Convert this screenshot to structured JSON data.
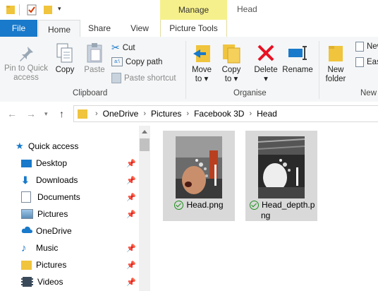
{
  "window": {
    "title": "Head",
    "contextual_tab": "Manage"
  },
  "tabs": [
    "File",
    "Home",
    "Share",
    "View",
    "Picture Tools"
  ],
  "ribbon": {
    "clipboard": {
      "pin_label": "Pin to Quick\naccess",
      "copy_label": "Copy",
      "paste_label": "Paste",
      "cut_label": "Cut",
      "copy_path_label": "Copy path",
      "paste_shortcut_label": "Paste shortcut",
      "group_label": "Clipboard"
    },
    "organise": {
      "move_to_label": "Move\nto ▾",
      "copy_to_label": "Copy\nto ▾",
      "delete_label": "Delete\n▾",
      "rename_label": "Rename",
      "group_label": "Organise"
    },
    "new": {
      "new_folder_label": "New\nfolder",
      "new_item_label": "New",
      "easy_access_label": "Eas",
      "group_label": "New"
    }
  },
  "breadcrumb": [
    "OneDrive",
    "Pictures",
    "Facebook 3D",
    "Head"
  ],
  "nav": [
    {
      "label": "Quick access",
      "icon": "star-icon",
      "pinned": false
    },
    {
      "label": "Desktop",
      "icon": "desktop-icon",
      "pinned": true
    },
    {
      "label": "Downloads",
      "icon": "download-arrow-icon",
      "pinned": true
    },
    {
      "label": "Documents",
      "icon": "documents-icon",
      "pinned": true
    },
    {
      "label": "Pictures",
      "icon": "pictures-icon",
      "pinned": true
    },
    {
      "label": "OneDrive",
      "icon": "cloud-icon",
      "pinned": false
    },
    {
      "label": "Music",
      "icon": "music-note-icon",
      "pinned": true
    },
    {
      "label": "Pictures",
      "icon": "folder-icon",
      "pinned": true
    },
    {
      "label": "Videos",
      "icon": "film-icon",
      "pinned": true
    }
  ],
  "files": [
    {
      "name": "Head.png",
      "status": "synced",
      "line1": "Head.png",
      "line2": ""
    },
    {
      "name": "Head_depth.png",
      "status": "synced",
      "line1": "Head_depth.p",
      "line2": "ng"
    }
  ],
  "colors": {
    "file_tab": "#1979ca",
    "manage_highlight": "#f6f08c",
    "delete_red": "#e81123",
    "folder_yellow": "#f0c43c",
    "sync_green": "#1f8f1f"
  }
}
